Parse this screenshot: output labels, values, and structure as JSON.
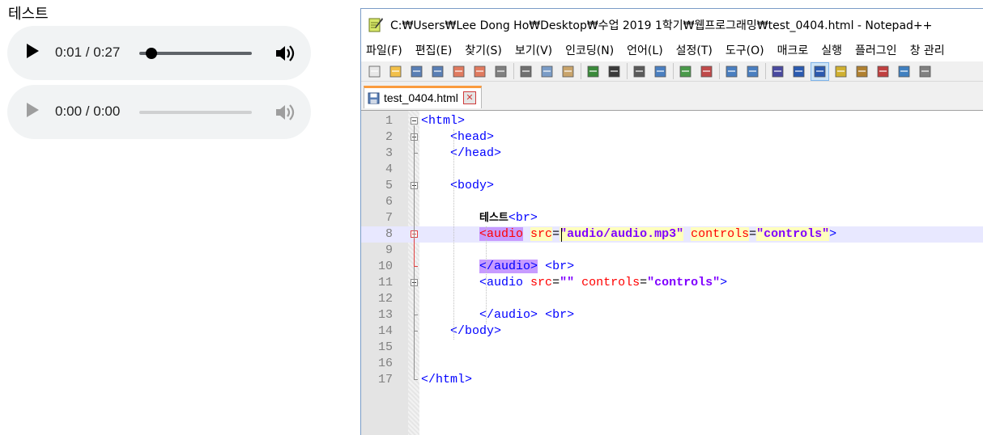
{
  "page": {
    "text": "테스트",
    "player1": {
      "time": "0:01 / 0:27",
      "progress": 0.04,
      "state": "enabled"
    },
    "player2": {
      "time": "0:00 / 0:00",
      "progress": 0,
      "state": "disabled"
    },
    "icons": {
      "play": "play-icon",
      "volume": "volume-icon"
    }
  },
  "npp": {
    "title": "C:₩Users₩Lee Dong Ho₩Desktop₩수업 2019 1학기₩웹프로그래밍₩test_0404.html - Notepad++",
    "menu": [
      "파일(F)",
      "편집(E)",
      "찾기(S)",
      "보기(V)",
      "인코딩(N)",
      "언어(L)",
      "설정(T)",
      "도구(O)",
      "매크로",
      "실행",
      "플러그인",
      "창 관리"
    ],
    "tab": {
      "label": "test_0404.html",
      "close": "✕"
    },
    "toolbar_icons": [
      "new-file-icon",
      "open-file-icon",
      "save-icon",
      "save-all-icon",
      "close-icon",
      "close-all-icon",
      "print-icon",
      "cut-icon",
      "copy-icon",
      "paste-icon",
      "undo-icon",
      "redo-icon",
      "find-icon",
      "replace-icon",
      "zoom-in-icon",
      "zoom-out-icon",
      "sync-vertical-icon",
      "sync-horizontal-icon",
      "word-wrap-icon",
      "show-all-chars-icon",
      "indent-guide-icon",
      "doc-map-icon",
      "function-list-icon",
      "folder-workspace-icon",
      "monitor-icon",
      "preview-icon"
    ],
    "lines": [
      {
        "n": "1",
        "text": "<html>"
      },
      {
        "n": "2",
        "text": "    <head>"
      },
      {
        "n": "3",
        "text": "    </head>"
      },
      {
        "n": "4",
        "text": ""
      },
      {
        "n": "5",
        "text": "    <body>"
      },
      {
        "n": "6",
        "text": ""
      },
      {
        "n": "7",
        "text": "        테스트<br>"
      },
      {
        "n": "8",
        "text": "        <audio src=\"audio/audio.mp3\" controls=\"controls\">"
      },
      {
        "n": "9",
        "text": ""
      },
      {
        "n": "10",
        "text": "        </audio> <br>"
      },
      {
        "n": "11",
        "text": "        <audio src=\"\" controls=\"controls\">"
      },
      {
        "n": "12",
        "text": ""
      },
      {
        "n": "13",
        "text": "        </audio> <br>"
      },
      {
        "n": "14",
        "text": "    </body>"
      },
      {
        "n": "15",
        "text": ""
      },
      {
        "n": "16",
        "text": ""
      },
      {
        "n": "17",
        "text": "</html>"
      }
    ],
    "current_line": 8
  },
  "colors": {
    "tag": "#0000ff",
    "attr": "#ff0000",
    "value": "#8000ff",
    "tab_accent": "#fa9b3e",
    "current_line": "#e8e8ff",
    "tag_match": "#c79bff"
  }
}
